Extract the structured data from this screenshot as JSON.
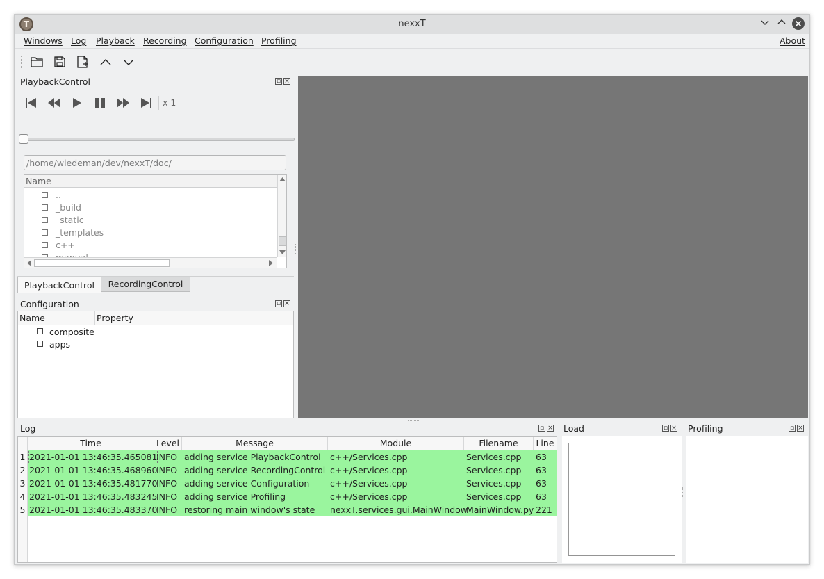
{
  "window": {
    "title": "nexxT",
    "logo_glyph": "T"
  },
  "menubar": {
    "items": [
      {
        "label": "Windows"
      },
      {
        "label": "Log"
      },
      {
        "label": "Playback"
      },
      {
        "label": "Recording"
      },
      {
        "label": "Configuration"
      },
      {
        "label": "Profiling"
      }
    ],
    "about": "About"
  },
  "toolbar": {
    "buttons": [
      "open-folder-icon",
      "save-icon",
      "new-file-icon",
      "chevron-up-icon",
      "chevron-down-icon"
    ]
  },
  "playback_dock": {
    "title": "PlaybackControl",
    "speed": "x 1",
    "position_fraction": 0,
    "path": "/home/wiedeman/dev/nexxT/doc/",
    "browser_header": "Name",
    "files": [
      "..",
      "_build",
      "_static",
      "_templates",
      "c++",
      "manual"
    ]
  },
  "tabs": [
    {
      "label": "PlaybackControl",
      "active": true
    },
    {
      "label": "RecordingControl",
      "active": false
    }
  ],
  "config_dock": {
    "title": "Configuration",
    "columns": [
      "Name",
      "Property"
    ],
    "items": [
      "composite",
      "apps"
    ]
  },
  "log_dock": {
    "title": "Log",
    "columns": [
      "Time",
      "Level",
      "Message",
      "Module",
      "Filename",
      "Line"
    ],
    "rows": [
      {
        "n": "1",
        "time": "2021-01-01 13:46:35.465081",
        "level": "INFO",
        "message": "adding service PlaybackControl",
        "module": "c++/Services.cpp",
        "filename": "Services.cpp",
        "line": "63"
      },
      {
        "n": "2",
        "time": "2021-01-01 13:46:35.468960",
        "level": "INFO",
        "message": "adding service RecordingControl",
        "module": "c++/Services.cpp",
        "filename": "Services.cpp",
        "line": "63"
      },
      {
        "n": "3",
        "time": "2021-01-01 13:46:35.481770",
        "level": "INFO",
        "message": "adding service Configuration",
        "module": "c++/Services.cpp",
        "filename": "Services.cpp",
        "line": "63"
      },
      {
        "n": "4",
        "time": "2021-01-01 13:46:35.483245",
        "level": "INFO",
        "message": "adding service Profiling",
        "module": "c++/Services.cpp",
        "filename": "Services.cpp",
        "line": "63"
      },
      {
        "n": "5",
        "time": "2021-01-01 13:46:35.483370",
        "level": "INFO",
        "message": "restoring main window's state",
        "module": "nexxT.services.gui.MainWindow",
        "filename": "MainWindow.py",
        "line": "221"
      }
    ],
    "row_color": "#9af59e"
  },
  "load_dock": {
    "title": "Load"
  },
  "profiling_dock": {
    "title": "Profiling"
  },
  "colors": {
    "central_area": "#767676",
    "log_highlight": "#9af59e"
  }
}
